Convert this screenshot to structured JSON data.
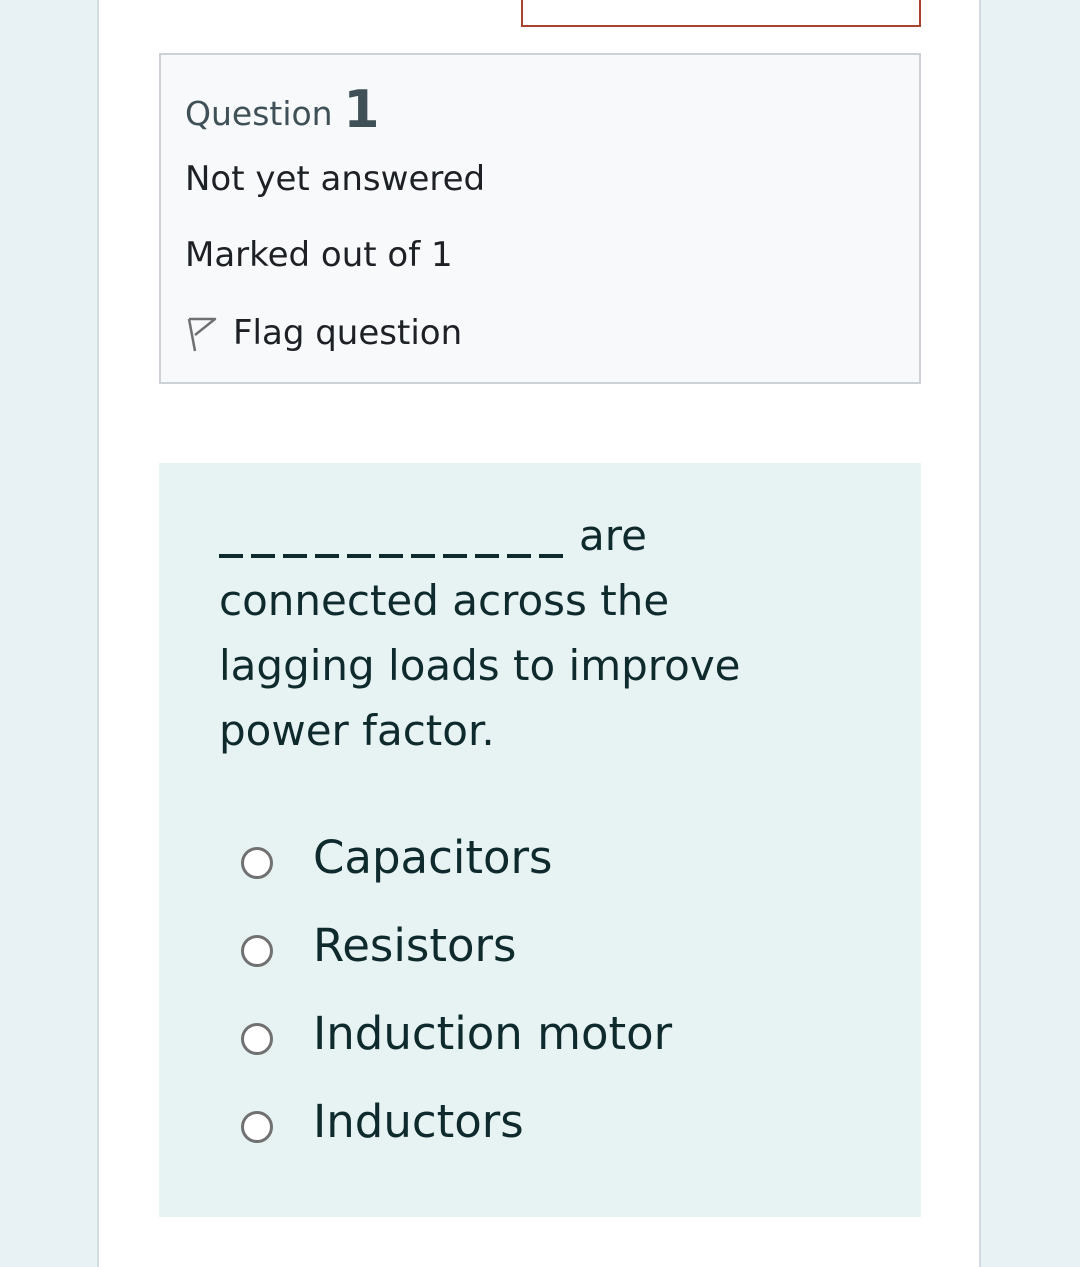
{
  "question_info": {
    "label": "Question",
    "number": "1",
    "state": "Not yet answered",
    "grade": "Marked out of 1",
    "flag_label": "Flag question",
    "flag_icon": "flag-icon"
  },
  "question": {
    "text_after_blank": "are connected across the lagging loads to improve power factor.",
    "answers": [
      {
        "label": "Capacitors",
        "selected": false
      },
      {
        "label": "Resistors",
        "selected": false
      },
      {
        "label": "Induction motor",
        "selected": false
      },
      {
        "label": "Inductors",
        "selected": false
      }
    ]
  },
  "colors": {
    "background": "#e8f1f4",
    "content_bg": "#e7f2f3",
    "info_bg": "#f7f9fa",
    "accent_border": "#a8432d"
  }
}
